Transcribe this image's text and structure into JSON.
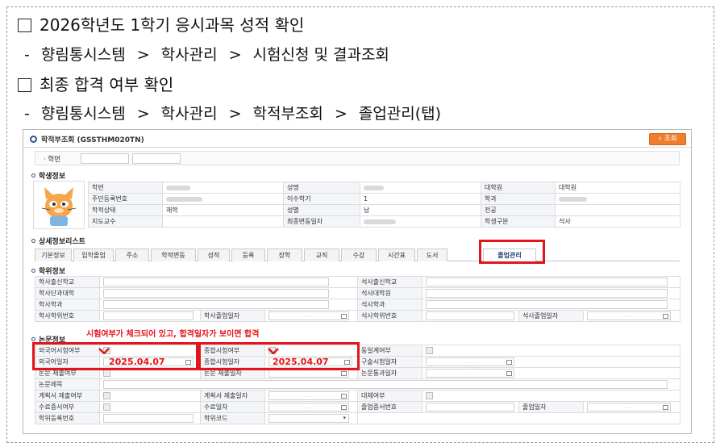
{
  "doc": {
    "heading1": "2026학년도 1학기 응시과목 성적 확인",
    "path1": [
      "-",
      "향림통시스템",
      ">",
      "학사관리",
      ">",
      "시험신청 및 결과조회"
    ],
    "heading2": "최종 합격 여부 확인",
    "path2": [
      "-",
      "향림통시스템",
      ">",
      "학사관리",
      ">",
      "학적부조회",
      ">",
      "졸업관리(탭)"
    ]
  },
  "screen": {
    "title": "학적부조회 (GSSTHM020TN)",
    "search_button": "조회",
    "id_label": "학번",
    "student_section": "학생정보",
    "student_rows": [
      [
        "학번",
        "",
        "성명",
        "",
        "대학원",
        "대학원"
      ],
      [
        "주민등록번호",
        "",
        "이수학기",
        "1",
        "학과",
        ""
      ],
      [
        "학적상태",
        "재학",
        "성별",
        "남",
        "전공",
        ""
      ],
      [
        "지도교수",
        "",
        "최종변동일자",
        "",
        "학생구분",
        "석사"
      ]
    ],
    "detail_section": "상세정보리스트",
    "tabs": [
      "기본정보",
      "입학졸업",
      "주소",
      "학적변동",
      "성적",
      "등록",
      "장학",
      "교직",
      "수강",
      "시간표",
      "도서",
      "졸업관리"
    ],
    "degree_section": "학위정보",
    "degree_rows": [
      [
        "학사출신학교",
        "",
        "석사출신학교",
        ""
      ],
      [
        "학사단과대학",
        "",
        "석사대학원",
        ""
      ],
      [
        "학사학과",
        "",
        "석사학과",
        ""
      ]
    ],
    "degree_last": [
      "학사학위번호",
      "학사졸업일자",
      "석사학위번호",
      "석사졸업일자"
    ],
    "date_placeholder": ". .",
    "thesis_section": "논문정보",
    "thesis": {
      "foreign_exam": "외국어시험여부",
      "comp_exam": "종합시험여부",
      "same_year": "동일계여부",
      "foreign_date": "외국어일자",
      "foreign_date_value": "2025.04.07",
      "comp_date": "종합시험일자",
      "comp_date_value": "2025.04.07",
      "oral_date": "구술시험일자",
      "submit_flag": "논문 제출여부",
      "submit_date": "논문 제출일자",
      "pass_date": "논문통과일자",
      "title": "논문제목",
      "plan_flag": "계획서 제출여부",
      "plan_date": "계획서 제출일자",
      "replace_flag": "대체여부",
      "cert_flag": "수료증서여부",
      "cert_date": "수료일자",
      "grad_cert_no": "졸업증서번호",
      "grad_date": "졸업일자",
      "degree_reg_no": "학위등록번호",
      "degree_code": "학위코드"
    },
    "annotation": "시험여부가 체크되어 있고, 합격일자가 보이면 합격"
  },
  "colors": {
    "highlight": "#e4141b",
    "accent": "#f07d2c",
    "navy": "#2b4f8e"
  }
}
